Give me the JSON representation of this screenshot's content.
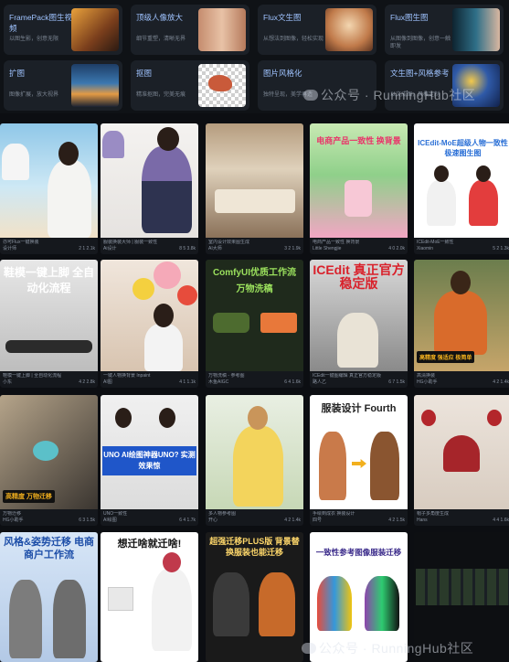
{
  "features": [
    {
      "title": "FramePack图生视频",
      "desc": "以图生影，创意无限"
    },
    {
      "title": "顶级人像放大",
      "desc": "细节重塑，清晰无界"
    },
    {
      "title": "Flux文生图",
      "desc": "从想法到图像，轻松实现"
    },
    {
      "title": "Flux图生图",
      "desc": "从图像到图像，创意一触即发"
    },
    {
      "title": "扩图",
      "desc": "图像扩展，放大视界"
    },
    {
      "title": "抠图",
      "desc": "精准抠图，完美无痕"
    },
    {
      "title": "图片风格化",
      "desc": "独特呈现，美学再造"
    },
    {
      "title": "文生图+风格参考",
      "desc": "以文成图，风格定制"
    }
  ],
  "watermark": "公众号 · RunningHub社区",
  "gallery": [
    {
      "headline": "",
      "caption": "亦可Flux一键换装",
      "author": "设计师",
      "stats": "2  1  2.1k"
    },
    {
      "headline": "",
      "caption": "服装换装大师 | 服装一致性",
      "author": "Ai设计",
      "stats": "8  5  3.8k"
    },
    {
      "headline": "",
      "caption": "室内设计效果图生成",
      "author": "AI大师",
      "stats": "3  2  1.9k"
    },
    {
      "headline": "电商产品一致性 换背景",
      "caption": "电商产品一致性 换背景",
      "author": "Little Shengjie",
      "stats": "4  0  2.0k"
    },
    {
      "headline": "ICEdit-MoE超级人物一致性极速图生图",
      "caption": "ICEdit-MoE一致性",
      "author": "Xiaomin",
      "stats": "5  2  1.3k"
    },
    {
      "headline": "鞋模一键上脚 全自动化流程",
      "caption": "鞋模一键上脚 | 全自动化流程",
      "author": "小东",
      "stats": "4  2  2.8k"
    },
    {
      "headline": "",
      "caption": "一键人物换背景 Inpaint",
      "author": "AI图",
      "stats": "4  1  1.1k"
    },
    {
      "headline": "ComfyUI优质工作流 万物洗稿",
      "caption": "万物洗稿 - 参考图",
      "author": "木鱼AIGC",
      "stats": "6  4  1.6k"
    },
    {
      "headline": "ICEdit 真正官方稳定版",
      "caption": "ICEdit一键图编辑 真正官方稳定版",
      "author": "路人乙",
      "stats": "6  7  1.5k"
    },
    {
      "headline": "高精度 强适应 极简单",
      "caption": "高清换装",
      "author": "HG小助手",
      "stats": "4  2  1.4k"
    },
    {
      "headline": "高精度 万物迁移",
      "caption": "万物迁移",
      "author": "HG小助手",
      "stats": "6  3  1.5k"
    },
    {
      "headline": "UNO AI绘图神器UNO? 实测效果惊",
      "caption": "UNO一致性",
      "author": "AI绘图",
      "stats": "6  4  1.7k"
    },
    {
      "headline": "",
      "caption": "多人物参考图",
      "author": "开心",
      "stats": "4  2  1.4k"
    },
    {
      "headline": "服装设计 Fourth",
      "caption": "手绘到成衣 换装设计",
      "author": "四号",
      "stats": "4  2  1.5k"
    },
    {
      "headline": "",
      "caption": "帽子多角度生成",
      "author": "Hans",
      "stats": "4  4  1.6k"
    },
    {
      "headline": "风格&姿势迁移 电商商户工作流",
      "caption": "风格&姿势迁移",
      "author": "木鱼",
      "stats": "3  1  1.1k"
    },
    {
      "headline": "想迁啥就迁啥!",
      "caption": "万物迁移 Flux-Redux",
      "author": "AI人",
      "stats": "4  1  1.2k"
    },
    {
      "headline": "超强迁移PLUS版 背景替换服装也能迁移",
      "caption": "超强迁移PLUS版",
      "author": "AI Family",
      "stats": "5  2  2.2k"
    },
    {
      "headline": "一致性参考图像服装迁移",
      "caption": "服装迁移",
      "author": "ZeroTop",
      "stats": "3  1  1.1k"
    },
    {
      "headline": "",
      "caption": "",
      "author": "",
      "stats": ""
    }
  ]
}
